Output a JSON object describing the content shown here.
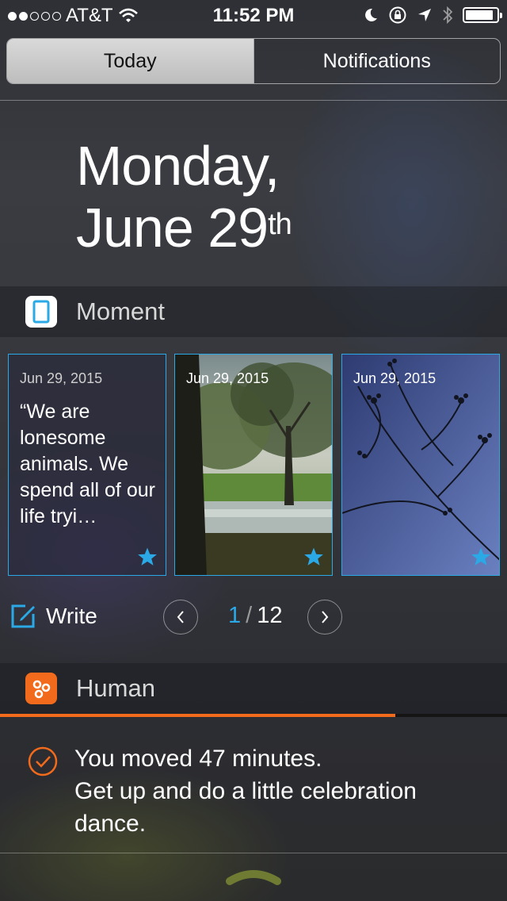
{
  "status_bar": {
    "carrier": "AT&T",
    "signal_bars_filled": 2,
    "signal_bars_total": 5,
    "time": "11:52 PM",
    "icons": [
      "wifi-icon",
      "moon-icon",
      "rotation-lock-icon",
      "location-arrow-icon",
      "bluetooth-icon",
      "battery-icon"
    ],
    "battery_level": 0.85
  },
  "segment": {
    "today": "Today",
    "notifications": "Notifications",
    "selected": "Today"
  },
  "date": {
    "line1": "Monday,",
    "line2": "June 29",
    "suffix": "th"
  },
  "moment": {
    "title": "Moment",
    "icon": "moment-app-icon",
    "accent": "#2aa9e6",
    "cards": [
      {
        "date": "Jun 29, 2015",
        "type": "quote",
        "text": "“We are lonesome animals. We spend all of our life tryi…",
        "starred": true
      },
      {
        "date": "Jun 29, 2015",
        "type": "photo",
        "description_icon": "park-photo",
        "starred": true
      },
      {
        "date": "Jun 29, 2015",
        "type": "photo",
        "description_icon": "branches-photo",
        "starred": true
      }
    ],
    "write_label": "Write",
    "page_current": "1",
    "page_separator": "/",
    "page_total": "12"
  },
  "human": {
    "title": "Human",
    "icon": "human-app-icon",
    "accent": "#f26a1b",
    "progress": 0.78,
    "line1": "You moved 47 minutes.",
    "line2": "Get up and do a little celebration dance."
  }
}
